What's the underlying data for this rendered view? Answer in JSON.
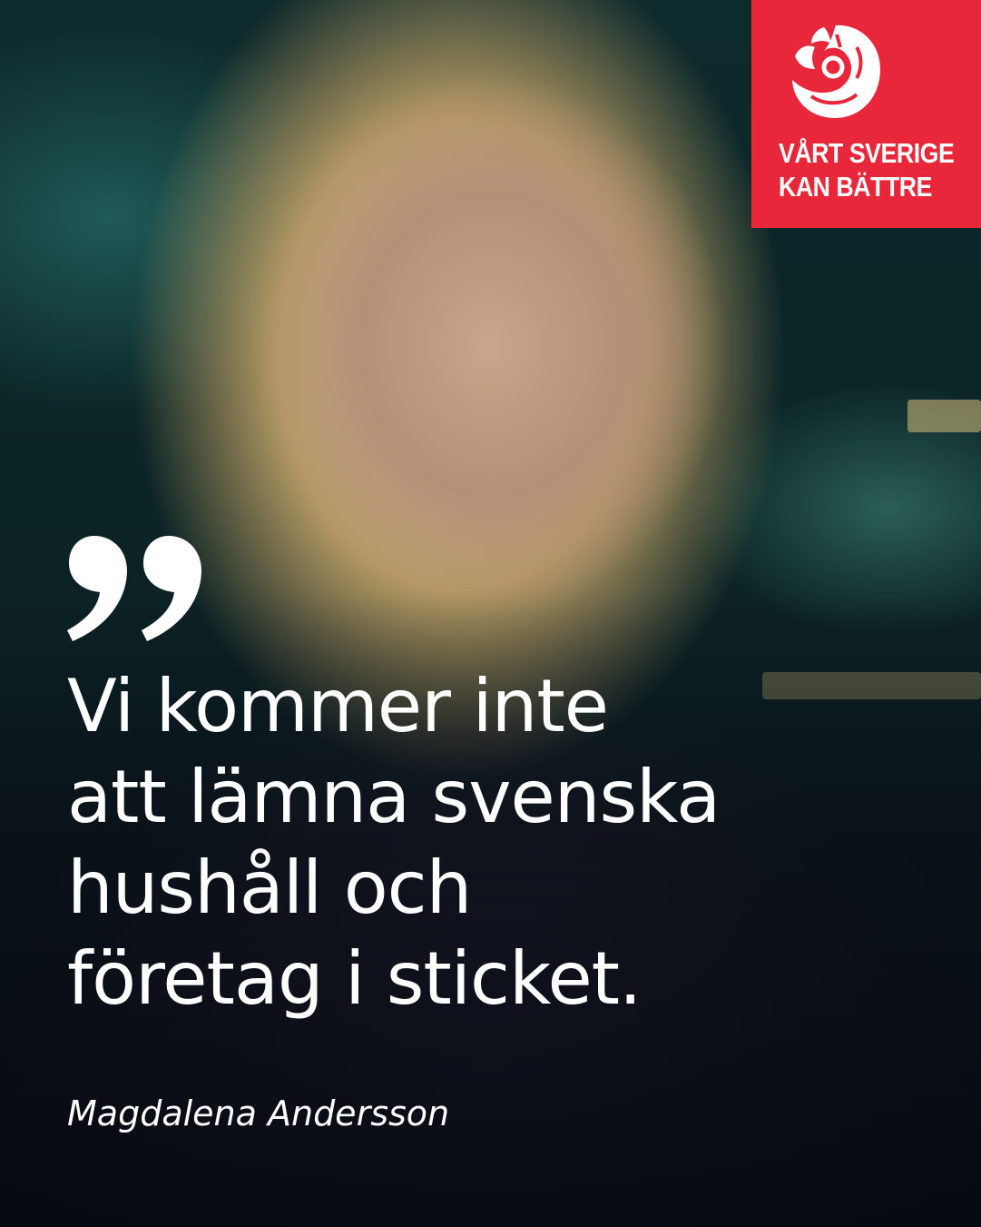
{
  "badge": {
    "line1": "VÅRT SVERIGE",
    "line2": "KAN BÄTTRE",
    "logo_icon": "rose-icon",
    "color": "#e8283a"
  },
  "quote": {
    "mark_icon": "quotation-mark-icon",
    "lines": [
      "Vi kommer inte",
      "att lämna svenska",
      "hushåll och",
      "företag i sticket."
    ]
  },
  "author": "Magdalena Andersson"
}
